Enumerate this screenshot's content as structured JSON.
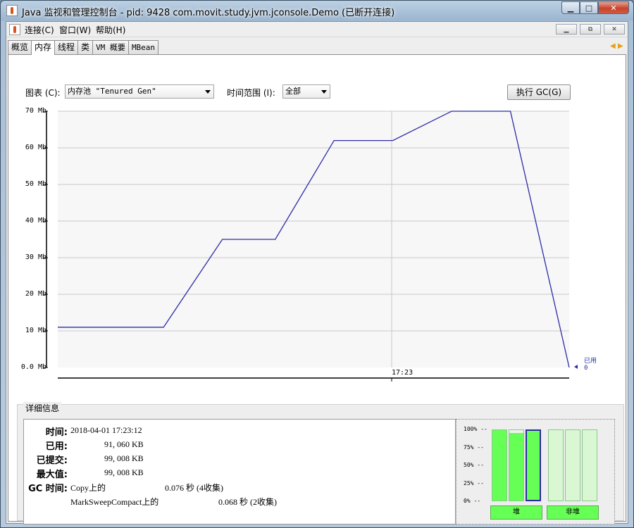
{
  "window": {
    "title": "Java 监视和管理控制台 - pid: 9428 com.movit.study.jvm.jconsole.Demo (已断开连接)"
  },
  "menubar": {
    "items": [
      "连接(C)",
      "窗口(W)",
      "帮助(H)"
    ]
  },
  "tabs": [
    {
      "label": "概览",
      "active": false
    },
    {
      "label": "内存",
      "active": true
    },
    {
      "label": "线程",
      "active": false
    },
    {
      "label": "类",
      "active": false
    },
    {
      "label": "VM 概要",
      "active": false
    },
    {
      "label": "MBean",
      "active": false
    }
  ],
  "controls": {
    "chart_label": "图表 (C):",
    "chart_value": "内存池 \"Tenured Gen\"",
    "range_label": "时间范围 (I):",
    "range_value": "全部",
    "gc_button": "执行 GC(G)"
  },
  "chart_data": {
    "type": "line",
    "yticks": [
      "0.0 Mb",
      "10 Mb",
      "20 Mb",
      "30 Mb",
      "40 Mb",
      "50 Mb",
      "60 Mb",
      "70 Mb"
    ],
    "ylim": [
      0,
      70
    ],
    "xtick_label": "17:23",
    "grid": true,
    "series": [
      {
        "name": "已用",
        "color": "#2b2ba8",
        "x": [
          0,
          1.8,
          2.8,
          3.7,
          4.7,
          5.7,
          6.7,
          7.7,
          8.7
        ],
        "values": [
          11,
          11,
          35,
          35,
          62,
          62,
          70,
          70,
          0
        ]
      }
    ],
    "legend_label": "已用",
    "legend_value": "0"
  },
  "details": {
    "title": "详细信息",
    "rows": [
      {
        "key": "时间:",
        "value": "2018-04-01 17:23:12"
      },
      {
        "key": "已用:",
        "value": "91, 060 KB"
      },
      {
        "key": "已提交:",
        "value": "99, 008 KB"
      },
      {
        "key": "最大值:",
        "value": "99, 008 KB"
      }
    ],
    "gc_label": "GC 时间:",
    "gc_rows": [
      {
        "name": "Copy上的",
        "value": "0.076 秒 (4收集)"
      },
      {
        "name": "MarkSweepCompact上的",
        "value": "0.068 秒 (2收集)"
      }
    ]
  },
  "pools": {
    "pct_labels": [
      "100% --",
      "75% --",
      "50% --",
      "25% --",
      "0% --"
    ],
    "heap_bars": [
      1.0,
      0.96,
      1.0
    ],
    "nonheap_bars": [
      0.0,
      0.0,
      0.0
    ],
    "heap_label": "堆",
    "nonheap_label": "非堆",
    "colors": {
      "heap": "#66ff55",
      "nonheap": "#b8ffad",
      "selected_border": "#2a2aa8"
    }
  }
}
